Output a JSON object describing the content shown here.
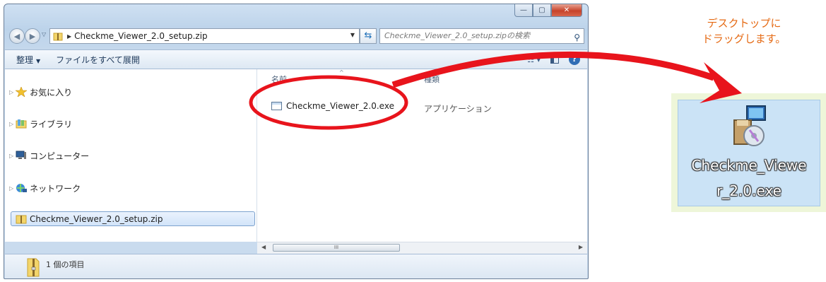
{
  "window": {
    "caption_buttons": {
      "minimize": "—",
      "maximize": "▢",
      "close": "✕"
    },
    "address": {
      "back_icon": "back-arrow-icon",
      "forward_icon": "forward-arrow-icon",
      "path": "Checkme_Viewer_2.0_setup.zip",
      "search_placeholder": "Checkme_Viewer_2.0_setup.zipの検索"
    },
    "toolbar": {
      "organize": "整理",
      "extract_all": "ファイルをすべて展開"
    },
    "nav": {
      "items": [
        {
          "label": "お気に入り",
          "icon": "star-icon"
        },
        {
          "label": "ライブラリ",
          "icon": "library-icon"
        },
        {
          "label": "コンピューター",
          "icon": "computer-icon"
        },
        {
          "label": "ネットワーク",
          "icon": "network-icon"
        }
      ],
      "selected": "Checkme_Viewer_2.0_setup.zip"
    },
    "columns": {
      "name": "名前",
      "type": "種類"
    },
    "files": [
      {
        "name": "Checkme_Viewer_2.0.exe",
        "type": "アプリケーション"
      }
    ],
    "scrollbar_grip": "III",
    "status": "1 個の項目"
  },
  "annotation": {
    "line1": "デスクトップに",
    "line2": "ドラッグします。"
  },
  "desktop_icon": {
    "label_line1": "Checkme_Viewe",
    "label_line2": "r_2.0.exe"
  },
  "colors": {
    "highlight_red": "#e8141c",
    "annotation_orange": "#e56a14"
  }
}
